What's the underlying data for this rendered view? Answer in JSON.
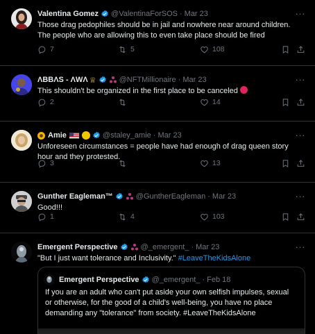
{
  "tweets": [
    {
      "name": "Valentina Gomez",
      "handle": "@ValentinaForSOS",
      "time": "Mar 23",
      "text": "Those drag pedophiles should be in jail and nowhere near around children. The people who are allowing this to even take place should be fired",
      "replies": "7",
      "retweets": "5",
      "likes": "108"
    },
    {
      "name": "ΛBBΛS - ΛWΛ",
      "handle": "@NFTMillionaire",
      "time": "Mar 23",
      "text": "This shouldn't be organized in the first place to be canceled",
      "replies": "2",
      "retweets": "",
      "likes": "14"
    },
    {
      "name": "Amie",
      "handle": "@staley_amie",
      "time": "Mar 23",
      "text": "Unforeseen circumstances = people have had enough of drag queen story hour and they protested.",
      "replies": "3",
      "retweets": "",
      "likes": "13"
    },
    {
      "name": "Gunther Eagleman™",
      "handle": "@GuntherEagleman",
      "time": "Mar 23",
      "text": "Good!!!",
      "replies": "1",
      "retweets": "4",
      "likes": "103"
    },
    {
      "name": "Emergent Perspective",
      "handle": "@_emergent_",
      "time": "Mar 23",
      "text": "\"But I just want tolerance and Inclusivity.\"",
      "hashtag": "#LeaveTheKidsAlone",
      "quote": {
        "name": "Emergent Perspective",
        "handle": "@_emergent_",
        "time": "Feb 18",
        "text": "If you are an adult who can't put aside your own selfish impulses, sexual or otherwise, for the good of a child's well-being, you have no place demanding any \"tolerance\" from society. #LeaveTheKidsAlone"
      }
    }
  ],
  "separator": "·",
  "more_label": "···",
  "colors": {
    "accent": "#1d9bf0",
    "muted": "#71767b",
    "text": "#e7e9ea",
    "border": "#2f3336",
    "verified": "#1d9bf0",
    "affiliate": "#c13584",
    "emoji_angry": "#e0245e"
  },
  "icons": [
    "reply-icon",
    "retweet-icon",
    "like-icon",
    "bookmark-icon",
    "share-icon",
    "verified-icon",
    "affiliate-icon",
    "more-icon"
  ]
}
